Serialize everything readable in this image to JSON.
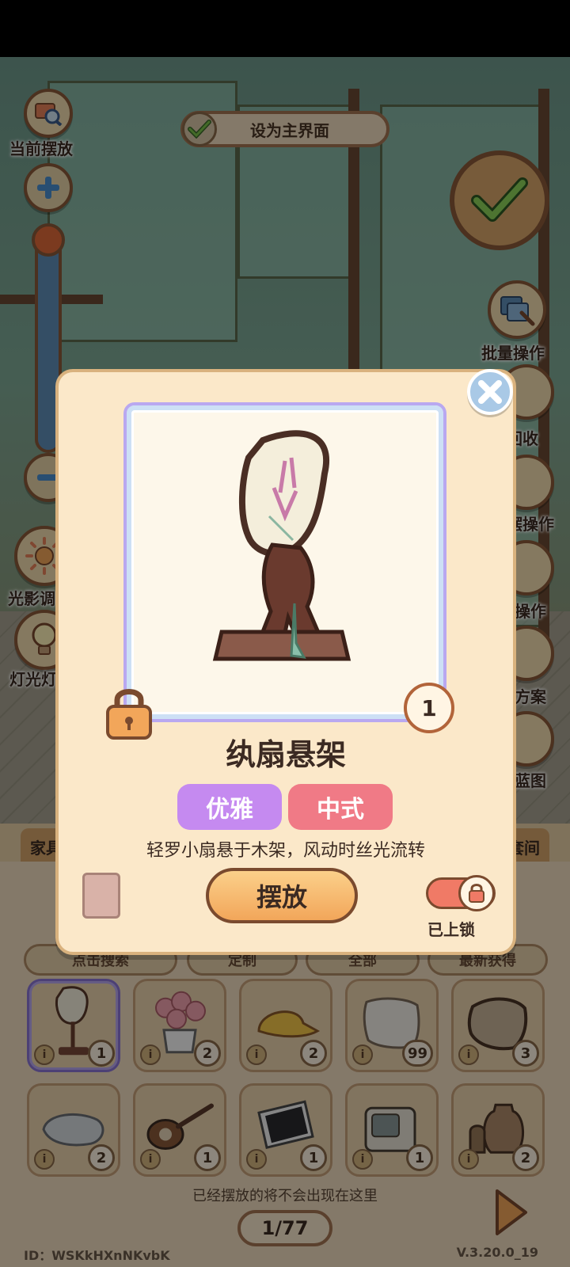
{
  "hud": {
    "current_placement": "当前摆放",
    "set_main": "设为主界面",
    "batch_ops": "批量操作",
    "light_shadow": "光影调",
    "lamp": "灯光灯",
    "right_labels": [
      "回收",
      "摆操作",
      "操作",
      "方案",
      "蓝图"
    ]
  },
  "dialog": {
    "item_name": "纨扇悬架",
    "quantity": "1",
    "tags": [
      "优雅",
      "中式"
    ],
    "description": "轻罗小扇悬于木架，风动时丝光流转",
    "place_button": "摆放",
    "lock_label": "已上锁",
    "locked": true
  },
  "inventory": {
    "tabs": [
      "家具",
      "套间"
    ],
    "filters": [
      "点击搜索",
      "定制",
      "全部",
      "最新获得"
    ],
    "slots": [
      {
        "name": "fan-stand",
        "count": "1",
        "selected": true
      },
      {
        "name": "rose-pot",
        "count": "2"
      },
      {
        "name": "yellow-cap",
        "count": "2"
      },
      {
        "name": "pillow",
        "count": "99"
      },
      {
        "name": "square-cushion",
        "count": "3"
      },
      {
        "name": "seal-plush",
        "count": "2"
      },
      {
        "name": "lute",
        "count": "1"
      },
      {
        "name": "monitor",
        "count": "1"
      },
      {
        "name": "retro-tv",
        "count": "1"
      },
      {
        "name": "clay-pots",
        "count": "2"
      }
    ],
    "note": "已经摆放的将不会出现在这里",
    "page": "1/77"
  },
  "footer": {
    "id": "ID：WSKkHXnNKvbK",
    "version": "V.3.20.0_19"
  },
  "colors": {
    "dialog_bg": "#fbe8c9",
    "tag_elegant": "#c58af0",
    "tag_chinese": "#f07a86",
    "place_button": "#f2a65a",
    "toggle_on": "#f07a66"
  }
}
